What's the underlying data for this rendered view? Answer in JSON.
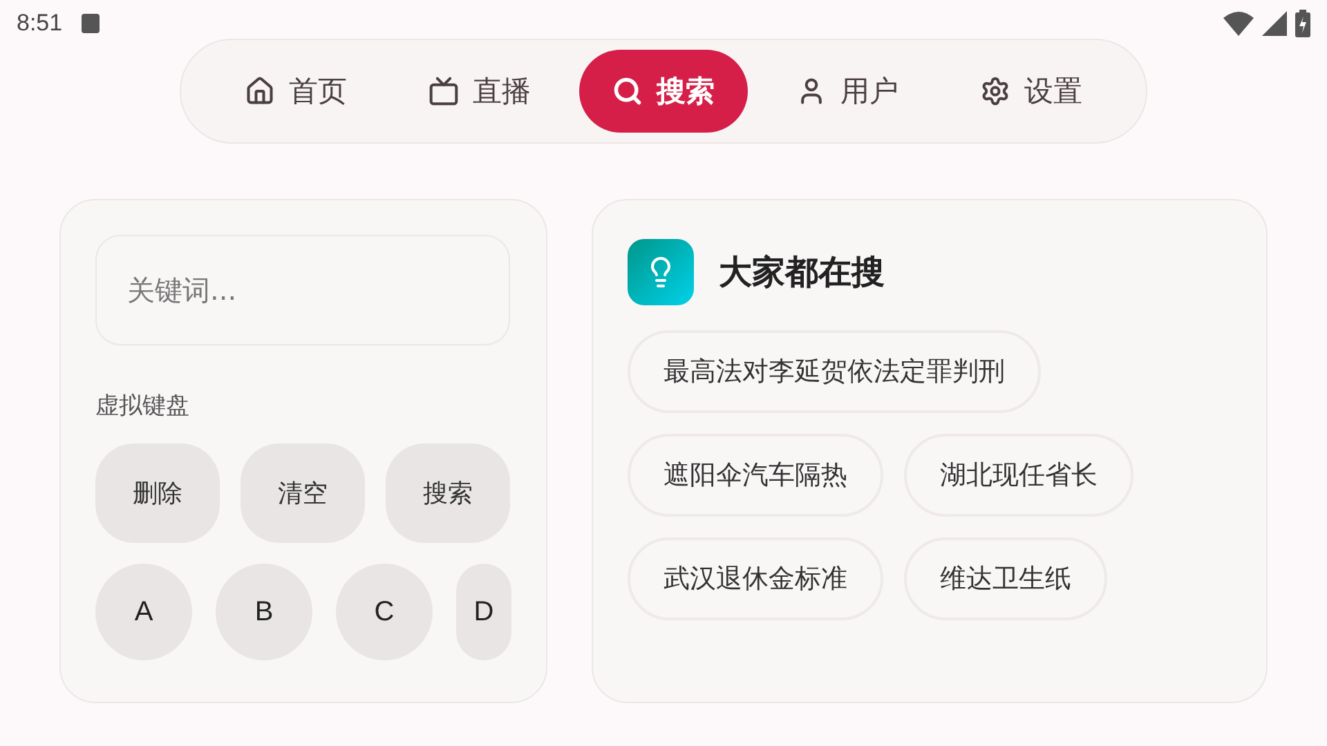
{
  "status_bar": {
    "time": "8:51"
  },
  "nav": {
    "tabs": [
      {
        "kind": "home",
        "label": "首页",
        "selected": false
      },
      {
        "kind": "tv",
        "label": "直播",
        "selected": false
      },
      {
        "kind": "search",
        "label": "搜索",
        "selected": true
      },
      {
        "kind": "user",
        "label": "用户",
        "selected": false
      },
      {
        "kind": "settings",
        "label": "设置",
        "selected": false
      }
    ]
  },
  "search_panel": {
    "input": {
      "placeholder": "关键词..."
    },
    "keyboard_label": "虚拟键盘",
    "actions": [
      "删除",
      "清空",
      "搜索"
    ],
    "keys": [
      "A",
      "B",
      "C",
      "D"
    ]
  },
  "trending": {
    "title": "大家都在搜",
    "chips": [
      [
        "最高法对李延贺依法定罪判刑"
      ],
      [
        "遮阳伞汽车隔热",
        "湖北现任省长"
      ],
      [
        "武汉退休金标准",
        "维达卫生纸"
      ]
    ]
  }
}
